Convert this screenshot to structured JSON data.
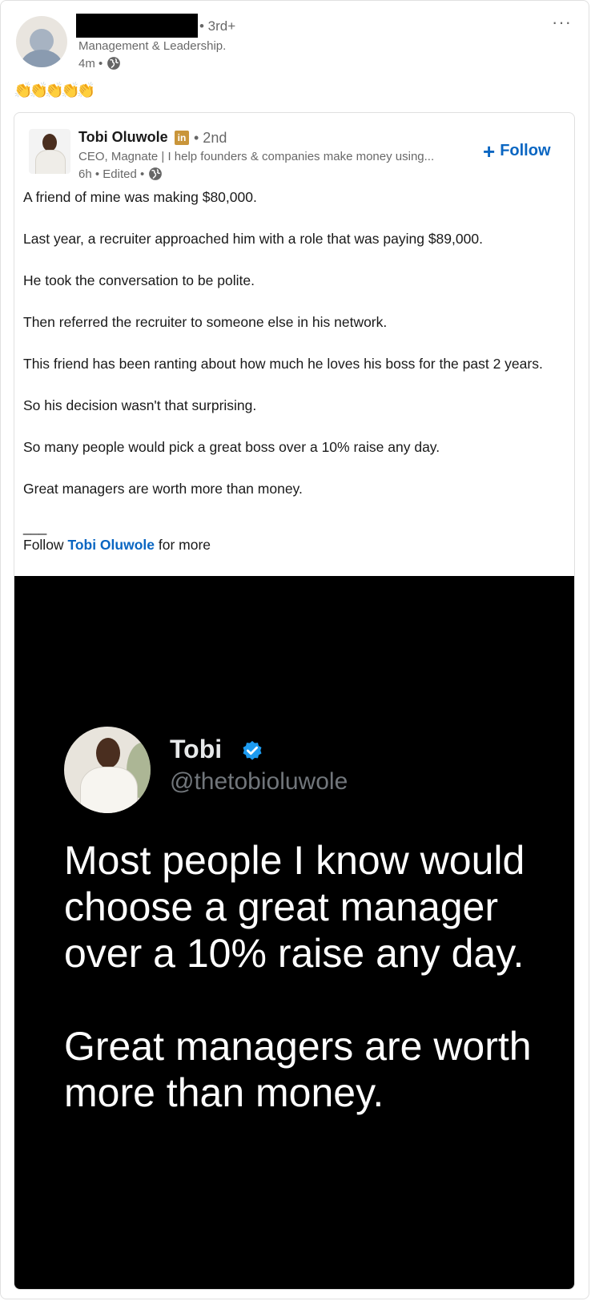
{
  "reposter": {
    "name_redacted": true,
    "degree": "• 3rd+",
    "headline": "Management & Leadership.",
    "time": "4m •",
    "more_label": "···",
    "reactions_text": "👏👏👏👏👏"
  },
  "post": {
    "author_name": "Tobi Oluwole",
    "badge_label": "in",
    "degree": "• 2nd",
    "headline": "CEO, Magnate | I help founders & companies make money using...",
    "time": "6h • Edited •",
    "follow_label": "Follow",
    "follow_plus": "+",
    "paragraphs": [
      "A friend of mine was making $80,000.",
      "Last year, a recruiter approached him with a role that was paying $89,000.",
      "He took the conversation to be polite.",
      "Then referred the recruiter to someone else in his network.",
      "This friend has been ranting about how much he loves his boss for the past 2 years.",
      "So his decision wasn't that surprising.",
      "So many people would pick a great boss over a 10% raise any day.",
      "Great managers are worth more than money."
    ],
    "divider": "___",
    "follow_prefix": "Follow ",
    "follow_mention": "Tobi Oluwole",
    "follow_suffix": " for more"
  },
  "tweet": {
    "name": "Tobi",
    "handle": "@thetobioluwole",
    "text_line1": "Most people I know would choose a great manager over a 10% raise any day.",
    "text_line2": "Great managers are worth more than money."
  },
  "colors": {
    "link_blue": "#0a66c2",
    "badge_gold": "#c9953a",
    "tweet_bg": "#000000",
    "verified_blue": "#1d9bf0"
  }
}
